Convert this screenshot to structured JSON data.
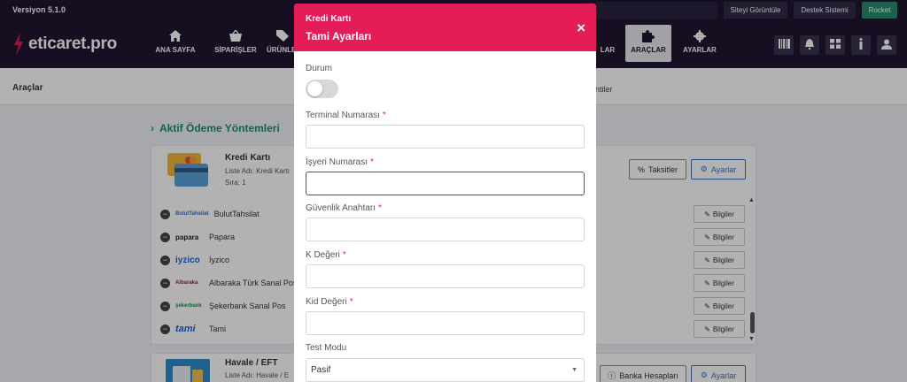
{
  "topbar": {
    "version": "Versiyon 5.1.0",
    "site_button": "Siteyi Görüntüle",
    "support_button": "Destek Sistemi",
    "user_button": "Rocket"
  },
  "logo": {
    "text": "eticaret.pro"
  },
  "nav": {
    "items": [
      {
        "label": "ANA SAYFA",
        "icon": "home-icon"
      },
      {
        "label": "SİPARİŞLER",
        "icon": "basket-icon"
      },
      {
        "label": "ÜRÜNLER",
        "icon": "tag-icon"
      },
      {
        "label": "LAR",
        "icon": "people-icon"
      },
      {
        "label": "ARAÇLAR",
        "icon": "puzzle-icon",
        "active": true
      },
      {
        "label": "AYARLAR",
        "icon": "gear-icon"
      }
    ]
  },
  "subbar": {
    "title": "Araçlar",
    "tab_right": "ntiler"
  },
  "content": {
    "section_title": "Aktif Ödeme Yöntemleri",
    "card1": {
      "title": "Kredi Kartı",
      "list_name": "Liste Adı: Kredi Kartı",
      "order": "Sıra: 1",
      "installments_button": "Taksitler",
      "settings_button": "Ayarlar",
      "info_label": "Bilgiler",
      "rows": [
        {
          "brand": "BulutTahsilat",
          "label": "BulutTahsilat"
        },
        {
          "brand": "papara",
          "label": "Papara"
        },
        {
          "brand": "iyzico",
          "label": "İyzico"
        },
        {
          "brand": "Albaraka",
          "label": "Albaraka Türk Sanal Pos"
        },
        {
          "brand": "şekerbank",
          "label": "Şekerbank Sanal Pos"
        },
        {
          "brand": "tami",
          "label": "Tami"
        }
      ]
    },
    "card2": {
      "title": "Havale / EFT",
      "list_name": "Liste Adı: Havale / E",
      "bank_button": "Banka Hesapları",
      "settings_button": "Ayarlar"
    }
  },
  "modal": {
    "title_small": "Kredi Kartı",
    "title": "Tami Ayarları",
    "close": "×",
    "status_label": "Durum",
    "status_on": false,
    "fields": [
      {
        "label": "Terminal Numarası",
        "required": "*",
        "value": ""
      },
      {
        "label": "İşyeri Numarası",
        "required": "*",
        "value": ""
      },
      {
        "label": "Güvenlik Anahtarı",
        "required": "*",
        "value": ""
      },
      {
        "label": "K Değeri",
        "required": "*",
        "value": ""
      },
      {
        "label": "Kid Değeri",
        "required": "*",
        "value": ""
      }
    ],
    "test_mode_label": "Test Modu",
    "test_mode_value": "Pasif"
  },
  "colors": {
    "header_bg": "#1f1630",
    "modal_accent": "#e41d58",
    "section_green": "#1b8f6b",
    "button_blue": "#3b6fbf"
  }
}
